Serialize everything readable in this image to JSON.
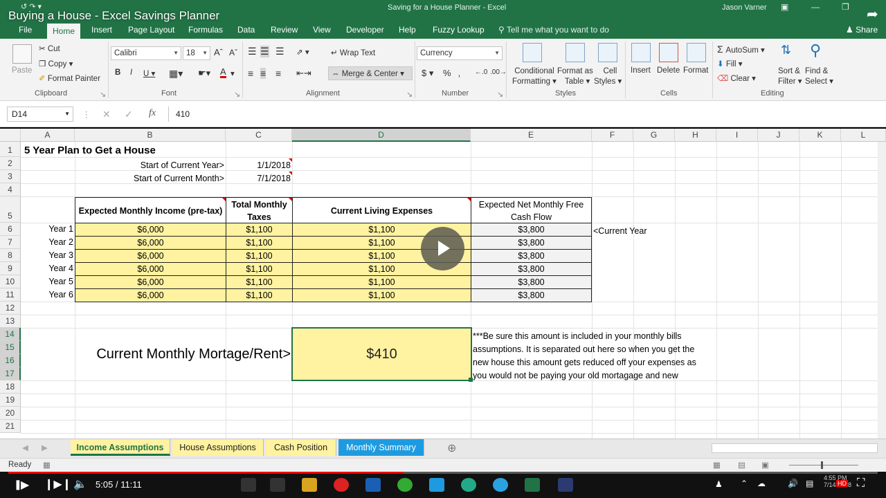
{
  "video": {
    "title": "Buying a House - Excel Savings Planner",
    "time_current": "5:05",
    "time_sep": "/",
    "time_total": "11:11",
    "progress": 0.4545
  },
  "window": {
    "title": "Saving for a House Planner  -  Excel",
    "user": "Jason Varner"
  },
  "tabs": [
    "File",
    "Home",
    "Insert",
    "Page Layout",
    "Formulas",
    "Data",
    "Review",
    "View",
    "Developer",
    "Help",
    "Fuzzy Lookup"
  ],
  "tell_me": "Tell me what you want to do",
  "share": "Share",
  "ribbon": {
    "clipboard": {
      "paste": "Paste",
      "cut": "Cut",
      "copy": "Copy",
      "format_painter": "Format Painter",
      "label": "Clipboard"
    },
    "font": {
      "name": "Calibri",
      "size": "18",
      "label": "Font"
    },
    "alignment": {
      "wrap_text": "Wrap Text",
      "merge_center": "Merge & Center",
      "label": "Alignment"
    },
    "number": {
      "format": "Currency",
      "label": "Number"
    },
    "styles": {
      "conditional_1": "Conditional",
      "conditional_2": "Formatting",
      "format_as_1": "Format as",
      "format_as_2": "Table",
      "cell_styles_1": "Cell",
      "cell_styles_2": "Styles",
      "label": "Styles"
    },
    "cells": {
      "insert": "Insert",
      "delete": "Delete",
      "format": "Format",
      "label": "Cells"
    },
    "editing": {
      "autosum": "AutoSum",
      "fill": "Fill",
      "clear": "Clear",
      "sort_1": "Sort &",
      "sort_2": "Filter",
      "find_1": "Find &",
      "find_2": "Select",
      "label": "Editing"
    }
  },
  "formula_bar": {
    "name_box": "D14",
    "value": "410"
  },
  "columns": [
    "A",
    "B",
    "C",
    "D",
    "E",
    "F",
    "G",
    "H",
    "I",
    "J",
    "K",
    "L"
  ],
  "rows": [
    "1",
    "2",
    "3",
    "4",
    "5",
    "6",
    "7",
    "8",
    "9",
    "10",
    "11",
    "12",
    "13",
    "14",
    "15",
    "16",
    "17",
    "18",
    "19",
    "20",
    "21"
  ],
  "sheet": {
    "title": "5 Year Plan to Get a House",
    "start_year_label": "Start of Current Year>",
    "start_year_value": "1/1/2018",
    "start_month_label": "Start of Current Month>",
    "start_month_value": "7/1/2018",
    "headers": {
      "income": "Expected Monthly Income (pre-tax)",
      "taxes_1": "Total Monthly",
      "taxes_2": "Taxes",
      "expenses": "Current Living Expenses",
      "free_1": "Expected Net Monthly Free",
      "free_2": "Cash Flow"
    },
    "table_rows": [
      {
        "label": "Year 1",
        "income": "$6,000",
        "taxes": "$1,100",
        "expenses": "$1,100",
        "free": "$3,800"
      },
      {
        "label": "Year 2",
        "income": "$6,000",
        "taxes": "$1,100",
        "expenses": "$1,100",
        "free": "$3,800"
      },
      {
        "label": "Year 3",
        "income": "$6,000",
        "taxes": "$1,100",
        "expenses": "$1,100",
        "free": "$3,800"
      },
      {
        "label": "Year 4",
        "income": "$6,000",
        "taxes": "$1,100",
        "expenses": "$1,100",
        "free": "$3,800"
      },
      {
        "label": "Year 5",
        "income": "$6,000",
        "taxes": "$1,100",
        "expenses": "$1,100",
        "free": "$3,800"
      },
      {
        "label": "Year 6",
        "income": "$6,000",
        "taxes": "$1,100",
        "expenses": "$1,100",
        "free": "$3,800"
      }
    ],
    "current_year_marker": "<Current Year",
    "mortgage_label": "Current Monthly Mortage/Rent>",
    "mortgage_value": "$410",
    "note_lines": [
      "***Be sure this amount is included in your monthly bills",
      "assumptions. It is separated out here so when you get the",
      "new house this amount gets reduced off your expenses as",
      "you would not be paying your old mortagage and new"
    ]
  },
  "sheet_tabs": [
    {
      "label": "Income Assumptions",
      "bg": "#fff2a0",
      "color": "#217346"
    },
    {
      "label": "House Assumptions",
      "bg": "#fff2a0",
      "color": "#222222"
    },
    {
      "label": "Cash Position",
      "bg": "#fff2a0",
      "color": "#222222"
    },
    {
      "label": "Monthly Summary",
      "bg": "#1e9be0",
      "color": "#ffffff"
    }
  ],
  "status": {
    "ready": "Ready"
  },
  "taskbar": {
    "clock": "4:55 PM",
    "date": "7/14/2018"
  },
  "colors": {
    "excel_green": "#217346",
    "cell_yellow": "#fff2a0",
    "progress_red": "#ee0000"
  }
}
